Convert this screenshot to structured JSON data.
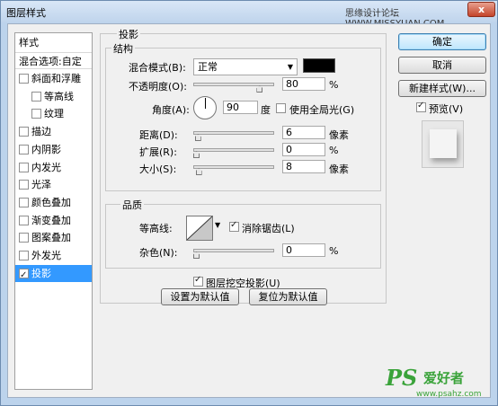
{
  "window": {
    "title": "图层样式",
    "watermark": "思缘设计论坛 WWW.MISSYUAN.COM",
    "close_glyph": "x"
  },
  "sidebar": {
    "header": "样式",
    "blend_options": "混合选项:自定",
    "items": [
      {
        "label": "斜面和浮雕",
        "checked": false
      },
      {
        "label": "等高线",
        "checked": false
      },
      {
        "label": "纹理",
        "checked": false
      },
      {
        "label": "描边",
        "checked": false
      },
      {
        "label": "内阴影",
        "checked": false
      },
      {
        "label": "内发光",
        "checked": false
      },
      {
        "label": "光泽",
        "checked": false
      },
      {
        "label": "颜色叠加",
        "checked": false
      },
      {
        "label": "渐变叠加",
        "checked": false
      },
      {
        "label": "图案叠加",
        "checked": false
      },
      {
        "label": "外发光",
        "checked": false
      },
      {
        "label": "投影",
        "checked": true
      }
    ]
  },
  "drop_shadow": {
    "group_title": "投影",
    "structure": {
      "title": "结构",
      "blend_mode_label": "混合模式(B):",
      "blend_mode_value": "正常",
      "shadow_color": "#000000",
      "opacity_label": "不透明度(O):",
      "opacity_value": "80",
      "opacity_unit": "%",
      "opacity_level": 0.8,
      "angle_label": "角度(A):",
      "angle_value": "90",
      "angle_unit": "度",
      "global_light_label": "使用全局光(G)",
      "global_light_checked": false,
      "distance_label": "距离(D):",
      "distance_value": "6",
      "distance_unit": "像素",
      "distance_level": 0.02,
      "spread_label": "扩展(R):",
      "spread_value": "0",
      "spread_unit": "%",
      "spread_level": 0.0,
      "size_label": "大小(S):",
      "size_value": "8",
      "size_unit": "像素",
      "size_level": 0.03
    },
    "quality": {
      "title": "品质",
      "contour_label": "等高线:",
      "anti_alias_label": "消除锯齿(L)",
      "anti_alias_checked": true,
      "noise_label": "杂色(N):",
      "noise_value": "0",
      "noise_unit": "%",
      "noise_level": 0.0
    },
    "knockout_label": "图层挖空投影(U)",
    "knockout_checked": true,
    "make_default_label": "设置为默认值",
    "reset_default_label": "复位为默认值"
  },
  "actions": {
    "ok_label": "确定",
    "cancel_label": "取消",
    "new_style_label": "新建样式(W)...",
    "preview_label": "预览(V)",
    "preview_checked": true
  },
  "logo": {
    "big": "PS",
    "cn": "爱好者",
    "url": "www.psahz.com"
  }
}
